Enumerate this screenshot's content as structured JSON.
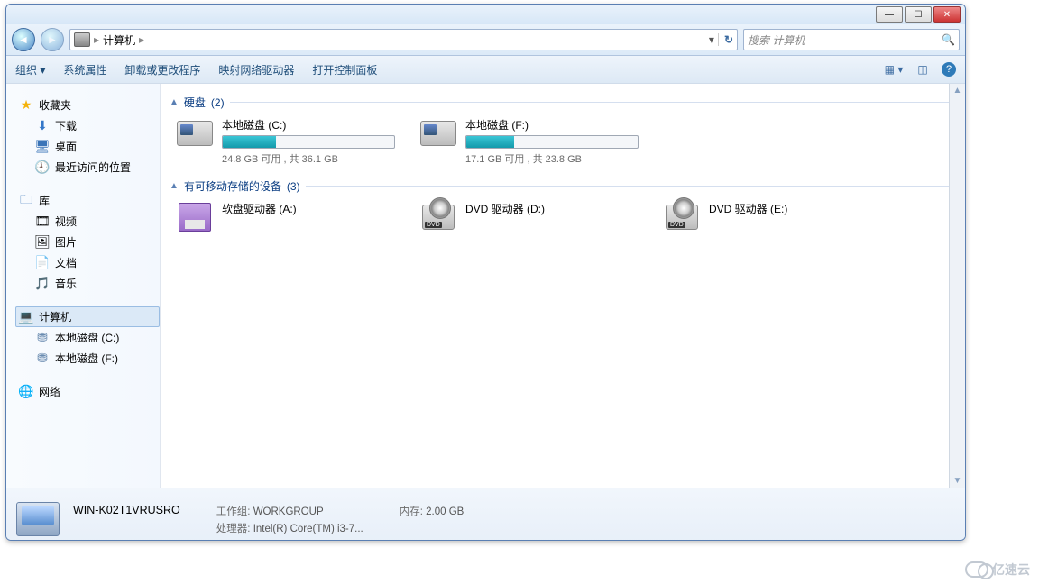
{
  "window_controls": {
    "min": "—",
    "max": "☐",
    "close": "✕"
  },
  "address": {
    "segments": [
      "计算机"
    ],
    "refresh": "↻"
  },
  "search": {
    "placeholder": "搜索 计算机",
    "mag": "🔍"
  },
  "toolbar": {
    "organize": "组织 ▾",
    "sysprops": "系统属性",
    "uninstall": "卸载或更改程序",
    "mapnet": "映射网络驱动器",
    "ctrlpanel": "打开控制面板"
  },
  "sidebar": {
    "favorites": {
      "title": "收藏夹",
      "items": [
        {
          "icon": "⬇",
          "name": "下载"
        },
        {
          "icon": "🖥",
          "name": "桌面"
        },
        {
          "icon": "🕘",
          "name": "最近访问的位置"
        }
      ]
    },
    "libraries": {
      "title": "库",
      "items": [
        {
          "icon": "🎞",
          "name": "视频"
        },
        {
          "icon": "🖼",
          "name": "图片"
        },
        {
          "icon": "📄",
          "name": "文档"
        },
        {
          "icon": "🎵",
          "name": "音乐"
        }
      ]
    },
    "computer": {
      "title": "计算机",
      "items": [
        {
          "icon": "⛃",
          "name": "本地磁盘 (C:)"
        },
        {
          "icon": "⛃",
          "name": "本地磁盘 (F:)"
        }
      ]
    },
    "network": {
      "title": "网络"
    }
  },
  "groups": {
    "hdd": {
      "title": "硬盘",
      "count": "(2)",
      "drives": [
        {
          "name": "本地磁盘 (C:)",
          "space": "24.8 GB 可用 , 共 36.1 GB",
          "used_pct": 31
        },
        {
          "name": "本地磁盘 (F:)",
          "space": "17.1 GB 可用 , 共 23.8 GB",
          "used_pct": 28
        }
      ]
    },
    "removable": {
      "title": "有可移动存储的设备",
      "count": "(3)",
      "drives": [
        {
          "name": "软盘驱动器 (A:)",
          "type": "floppy"
        },
        {
          "name": "DVD 驱动器 (D:)",
          "type": "dvd"
        },
        {
          "name": "DVD 驱动器 (E:)",
          "type": "dvd"
        }
      ]
    }
  },
  "details": {
    "name": "WIN-K02T1VRUSRO",
    "workgroup_label": "工作组:",
    "workgroup": "WORKGROUP",
    "cpu_label": "处理器:",
    "cpu": "Intel(R) Core(TM) i3-7...",
    "mem_label": "内存:",
    "mem": "2.00 GB"
  },
  "watermark": "亿速云"
}
